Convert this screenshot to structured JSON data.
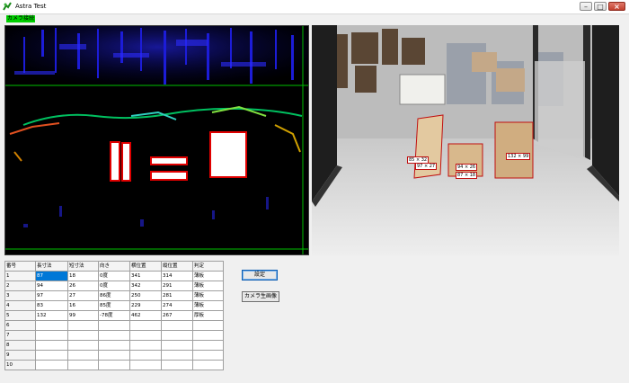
{
  "window": {
    "title": "Astra Test"
  },
  "status": {
    "label": "カメラ接続"
  },
  "detections": [
    {
      "label": "85 × 32"
    },
    {
      "label": "97 × 27"
    },
    {
      "label": "94 × 26"
    },
    {
      "label": "87 × 18"
    },
    {
      "label": "132 × 99"
    }
  ],
  "table": {
    "headers": [
      "番号",
      "長寸法",
      "短寸法",
      "向き",
      "横位置",
      "縦位置",
      "判定"
    ],
    "rows": [
      [
        "1",
        "87",
        "18",
        "0度",
        "341",
        "314",
        "薄板"
      ],
      [
        "2",
        "94",
        "26",
        "0度",
        "342",
        "291",
        "薄板"
      ],
      [
        "3",
        "97",
        "27",
        "86度",
        "250",
        "281",
        "薄板"
      ],
      [
        "4",
        "83",
        "16",
        "85度",
        "229",
        "274",
        "薄板"
      ],
      [
        "5",
        "132",
        "99",
        "-78度",
        "462",
        "267",
        "厚板"
      ],
      [
        "6",
        "",
        "",
        "",
        "",
        "",
        ""
      ],
      [
        "7",
        "",
        "",
        "",
        "",
        "",
        ""
      ],
      [
        "8",
        "",
        "",
        "",
        "",
        "",
        ""
      ],
      [
        "9",
        "",
        "",
        "",
        "",
        "",
        ""
      ],
      [
        "10",
        "",
        "",
        "",
        "",
        "",
        ""
      ]
    ]
  },
  "buttons": {
    "settings": "設定",
    "camera_raw": "カメラ生画像"
  }
}
